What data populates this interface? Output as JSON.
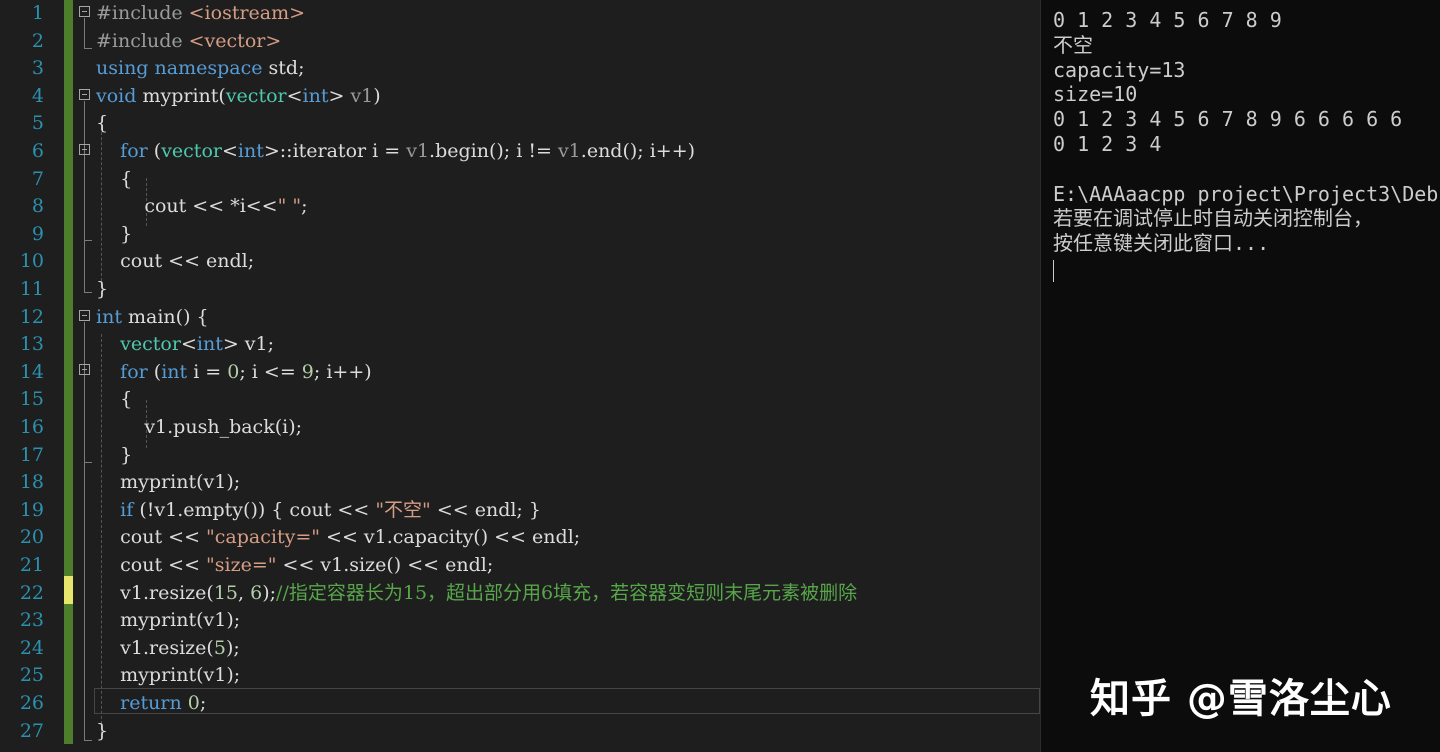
{
  "editor": {
    "line_numbers": [
      "1",
      "2",
      "3",
      "4",
      "5",
      "6",
      "7",
      "8",
      "9",
      "10",
      "11",
      "12",
      "13",
      "14",
      "15",
      "16",
      "17",
      "18",
      "19",
      "20",
      "21",
      "22",
      "23",
      "24",
      "25",
      "26",
      "27"
    ],
    "lines": [
      [
        {
          "t": "#include ",
          "c": "pp"
        },
        {
          "t": "<iostream>",
          "c": "inc"
        }
      ],
      [
        {
          "t": "#include ",
          "c": "pp"
        },
        {
          "t": "<vector>",
          "c": "inc"
        }
      ],
      [
        {
          "t": "using ",
          "c": "kw"
        },
        {
          "t": "namespace ",
          "c": "kw"
        },
        {
          "t": "std;",
          "c": ""
        }
      ],
      [
        {
          "t": "void ",
          "c": "kw"
        },
        {
          "t": "myprint",
          "c": ""
        },
        {
          "t": "(",
          "c": ""
        },
        {
          "t": "vector",
          "c": "typ"
        },
        {
          "t": "<",
          "c": ""
        },
        {
          "t": "int",
          "c": "kw"
        },
        {
          "t": "> ",
          "c": ""
        },
        {
          "t": "v1",
          "c": "prm"
        },
        {
          "t": ")",
          "c": ""
        }
      ],
      [
        {
          "t": "{",
          "c": ""
        }
      ],
      [
        {
          "t": "    ",
          "c": ""
        },
        {
          "t": "for ",
          "c": "kw"
        },
        {
          "t": "(",
          "c": ""
        },
        {
          "t": "vector",
          "c": "typ"
        },
        {
          "t": "<",
          "c": ""
        },
        {
          "t": "int",
          "c": "kw"
        },
        {
          "t": ">::iterator i = ",
          "c": ""
        },
        {
          "t": "v1",
          "c": "prm"
        },
        {
          "t": ".begin(); i != ",
          "c": ""
        },
        {
          "t": "v1",
          "c": "prm"
        },
        {
          "t": ".end(); i++)",
          "c": ""
        }
      ],
      [
        {
          "t": "    {",
          "c": ""
        }
      ],
      [
        {
          "t": "        cout << *i<<",
          "c": ""
        },
        {
          "t": "\" \"",
          "c": "str"
        },
        {
          "t": ";",
          "c": ""
        }
      ],
      [
        {
          "t": "    }",
          "c": ""
        }
      ],
      [
        {
          "t": "    cout << endl;",
          "c": ""
        }
      ],
      [
        {
          "t": "}",
          "c": ""
        }
      ],
      [
        {
          "t": "int ",
          "c": "kw"
        },
        {
          "t": "main() {",
          "c": ""
        }
      ],
      [
        {
          "t": "    ",
          "c": ""
        },
        {
          "t": "vector",
          "c": "typ"
        },
        {
          "t": "<",
          "c": ""
        },
        {
          "t": "int",
          "c": "kw"
        },
        {
          "t": "> v1;",
          "c": ""
        }
      ],
      [
        {
          "t": "    ",
          "c": ""
        },
        {
          "t": "for ",
          "c": "kw"
        },
        {
          "t": "(",
          "c": ""
        },
        {
          "t": "int ",
          "c": "kw"
        },
        {
          "t": "i = ",
          "c": ""
        },
        {
          "t": "0",
          "c": "num"
        },
        {
          "t": "; i <= ",
          "c": ""
        },
        {
          "t": "9",
          "c": "num"
        },
        {
          "t": "; i++)",
          "c": ""
        }
      ],
      [
        {
          "t": "    {",
          "c": ""
        }
      ],
      [
        {
          "t": "        v1.push_back(i);",
          "c": ""
        }
      ],
      [
        {
          "t": "    }",
          "c": ""
        }
      ],
      [
        {
          "t": "    myprint(v1);",
          "c": ""
        }
      ],
      [
        {
          "t": "    ",
          "c": ""
        },
        {
          "t": "if ",
          "c": "kw"
        },
        {
          "t": "(!v1.empty()) { cout << ",
          "c": ""
        },
        {
          "t": "\"不空\"",
          "c": "str"
        },
        {
          "t": " << endl; }",
          "c": ""
        }
      ],
      [
        {
          "t": "    cout << ",
          "c": ""
        },
        {
          "t": "\"capacity=\"",
          "c": "str"
        },
        {
          "t": " << v1.capacity() << endl;",
          "c": ""
        }
      ],
      [
        {
          "t": "    cout << ",
          "c": ""
        },
        {
          "t": "\"size=\"",
          "c": "str"
        },
        {
          "t": " << v1.size() << endl;",
          "c": ""
        }
      ],
      [
        {
          "t": "    v1.resize(",
          "c": ""
        },
        {
          "t": "15",
          "c": "num"
        },
        {
          "t": ", ",
          "c": ""
        },
        {
          "t": "6",
          "c": "num"
        },
        {
          "t": ");",
          "c": ""
        },
        {
          "t": "//指定容器长为15，超出部分用6填充，若容器变短则末尾元素被删除",
          "c": "cm"
        }
      ],
      [
        {
          "t": "    myprint(v1);",
          "c": ""
        }
      ],
      [
        {
          "t": "    v1.resize(",
          "c": ""
        },
        {
          "t": "5",
          "c": "num"
        },
        {
          "t": ");",
          "c": ""
        }
      ],
      [
        {
          "t": "    myprint(v1);",
          "c": ""
        }
      ],
      [
        {
          "t": "    ",
          "c": ""
        },
        {
          "t": "return ",
          "c": "kw"
        },
        {
          "t": "0",
          "c": "num"
        },
        {
          "t": ";",
          "c": ""
        }
      ],
      [
        {
          "t": "}",
          "c": ""
        }
      ]
    ]
  },
  "console": {
    "lines": [
      "0 1 2 3 4 5 6 7 8 9",
      "不空",
      "capacity=13",
      "size=10",
      "0 1 2 3 4 5 6 7 8 9 6 6 6 6 6",
      "0 1 2 3 4",
      "",
      "E:\\AAAaacpp project\\Project3\\Deb",
      "若要在调试停止时自动关闭控制台，",
      "按任意键关闭此窗口..."
    ]
  },
  "watermark": "知乎 @雪洛尘心",
  "colors": {
    "background": "#1e1e1e",
    "keyword": "#569cd6",
    "type": "#4ec9b0",
    "string": "#d69d85",
    "comment": "#57a64a",
    "number": "#b5cea8",
    "line_number": "#2b91af",
    "change_bar": "#4e7d2c",
    "change_bar_current": "#e6e66c",
    "console_bg": "#0c0c0c"
  }
}
